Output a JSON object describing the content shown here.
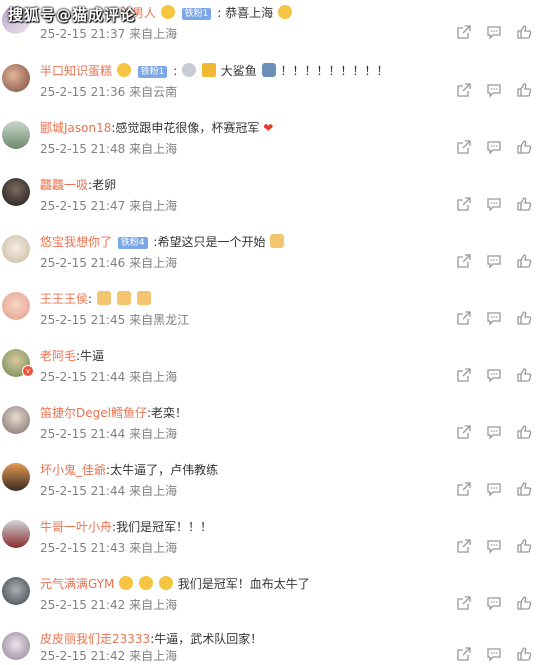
{
  "watermark": "搜狐号@猫成评论",
  "comments": [
    {
      "name": "的男人",
      "badge": "铁粉1",
      "colon": ":",
      "content": "恭喜上海",
      "time": "25-2-15 21:37",
      "loc": "来自上海"
    },
    {
      "name": "半口知识蛋糕",
      "badge": "铁粉1",
      "colon": ":",
      "content": "大鲨鱼",
      "extra": "！！！！！！！！！",
      "time": "25-2-15 21:36",
      "loc": "来自云南"
    },
    {
      "name": "郾城Jason18",
      "badge": "",
      "colon": ":",
      "content": "感觉跟申花很像，杯赛冠军",
      "time": "25-2-15 21:48",
      "loc": "来自上海"
    },
    {
      "name": "龘龘一吸",
      "badge": "",
      "colon": ":",
      "content": "老卵",
      "time": "25-2-15 21:47",
      "loc": "来自上海"
    },
    {
      "name": "悠宝我想你了",
      "badge": "铁粉4",
      "colon": ":",
      "content": "希望这只是一个开始",
      "time": "25-2-15 21:46",
      "loc": "来自上海"
    },
    {
      "name": "王王王侯",
      "badge": "",
      "colon": ":",
      "content": "",
      "time": "25-2-15 21:45",
      "loc": "来自黑龙江"
    },
    {
      "name": "老阿毛",
      "badge": "",
      "colon": ":",
      "content": "牛逼",
      "time": "25-2-15 21:44",
      "loc": "来自上海"
    },
    {
      "name": "笛捷尔Degel鳕鱼仔",
      "badge": "",
      "colon": ":",
      "content": "老栾！",
      "time": "25-2-15 21:44",
      "loc": "来自上海"
    },
    {
      "name": "坏小鬼_佳爺",
      "badge": "",
      "colon": ":",
      "content": "太牛逼了，卢伟教练",
      "time": "25-2-15 21:44",
      "loc": "来自上海"
    },
    {
      "name": "牛哥一叶小舟",
      "badge": "",
      "colon": ":",
      "content": "我们是冠军！！！",
      "time": "25-2-15 21:43",
      "loc": "来自上海"
    },
    {
      "name": "元气满满GYM",
      "badge": "",
      "colon": "",
      "content": "我们是冠军！血布太牛了",
      "time": "25-2-15 21:42",
      "loc": "来自上海"
    },
    {
      "name": "皮皮丽我们走23333",
      "badge": "",
      "colon": ":",
      "content": "牛逼，武术队回家！",
      "time": "25-2-15 21:42",
      "loc": "来自上海"
    }
  ],
  "icons": {
    "share": "share-icon",
    "comment": "comment-icon",
    "like": "like-icon"
  },
  "colors": {
    "username": "#eb7350",
    "meta": "#808080",
    "badge": "#7ba7e8"
  }
}
